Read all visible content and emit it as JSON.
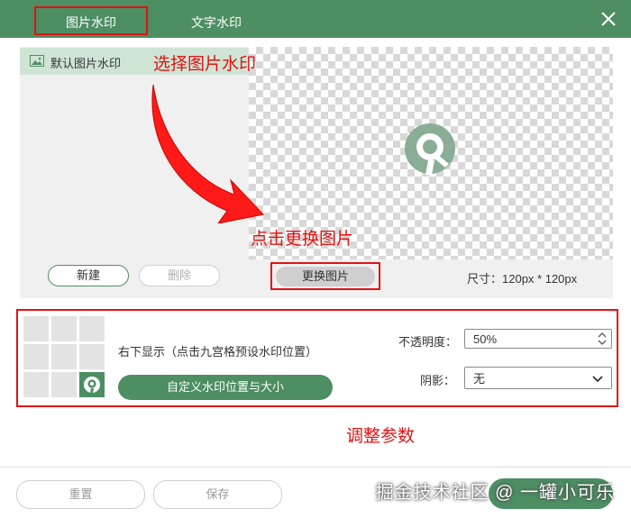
{
  "tabs": [
    {
      "label": "图片水印",
      "active": true
    },
    {
      "label": "文字水印",
      "active": false
    }
  ],
  "close_icon": "close-icon",
  "watermark_list": {
    "items": [
      {
        "label": "默认图片水印",
        "icon": "image-icon"
      }
    ],
    "new_label": "新建",
    "delete_label": "删除"
  },
  "preview": {
    "change_label": "更换图片",
    "size_label": "尺寸：120px * 120px",
    "watermark_icon": "watermark-logo-icon"
  },
  "position": {
    "description": "右下显示（点击九宫格预设水印位置）",
    "selected_cell": 9,
    "custom_label": "自定义水印位置与大小"
  },
  "opacity": {
    "label": "不透明度：",
    "value": "50%"
  },
  "shadow": {
    "label": "阴影：",
    "value": "无"
  },
  "footer": {
    "reset_label": "重置",
    "save_label": "保存"
  },
  "annotations": {
    "select_image": "选择图片水印",
    "change_image": "点击更换图片",
    "adjust_params": "调整参数"
  },
  "site_watermark": "掘金技术社区 @ 一罐小可乐",
  "colors": {
    "brand": "#4d8e63",
    "annotation": "#e21212",
    "selected_list_bg": "#cfe4d5"
  }
}
